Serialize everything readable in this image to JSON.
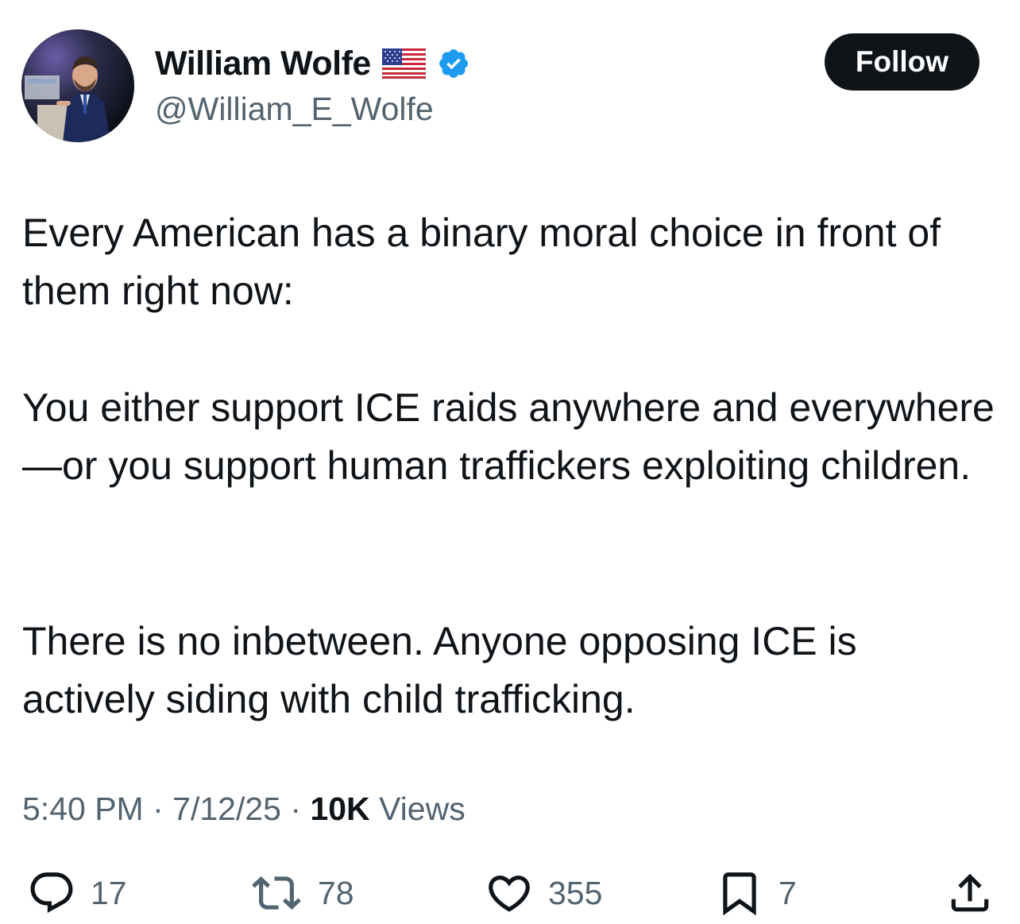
{
  "author": {
    "name": "William Wolfe",
    "handle": "@William_E_Wolfe",
    "flag_emoji": "us-flag",
    "verified": true
  },
  "follow_label": "Follow",
  "tweet": {
    "paragraphs": [
      "Every American has a binary moral choice in front of them right now:",
      "You either support ICE raids anywhere and everywhere—or you support human traffickers exploiting children.",
      "There is no inbetween. Anyone opposing ICE is actively siding with child trafficking."
    ]
  },
  "meta": {
    "time": "5:40 PM",
    "sep1": "·",
    "date": "7/12/25",
    "sep2": "·",
    "views_count": "10K",
    "views_label": "Views"
  },
  "actions": {
    "replies": "17",
    "reposts": "78",
    "likes": "355",
    "bookmarks": "7"
  },
  "colors": {
    "text": "#0f1419",
    "secondary": "#536471",
    "verified_blue": "#1d9bf0",
    "button_bg": "#0f1419"
  }
}
